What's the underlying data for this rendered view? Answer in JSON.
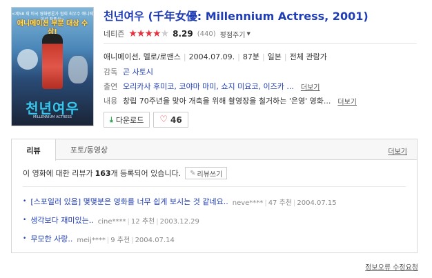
{
  "movie": {
    "title": "천년여우 (千年女優: Millennium Actress, 2001)",
    "poster": {
      "top_text": "<제58 회 미국 영화평론가 협회 최우수 애니메이션 작품상>",
      "headline": "애니메이션 부문 대상 수상!",
      "title_text": "천년여우",
      "subtitle": "MILLENNIUM ACTRESS"
    },
    "netizen_label": "네티즌",
    "stars_on": "★★★★",
    "stars_off": "★",
    "score": "8.29",
    "vote_count": "(440)",
    "rate_label": "평점주기",
    "genre": "애니메이션, 멜로/로맨스",
    "release_date": "2004.07.09.",
    "runtime": "87분",
    "country": "일본",
    "audience_rating": "전체 관람가",
    "director_label": "감독",
    "director": "곤 사토시",
    "cast_label": "출연",
    "cast": "오리카사 후미코, 코야마 마미, 쇼지 미요코, 이즈카 ...",
    "cast_more": "더보기",
    "plot_label": "내용",
    "plot": "창립 70주년을 맞아 개축을 위해 촬영장을 철거하는 '은영' 영화...",
    "plot_more": "더보기",
    "download_label": "다운로드",
    "like_count": "46"
  },
  "reviews": {
    "tabs": [
      "리뷰",
      "포토/동영상"
    ],
    "more_label": "더보기",
    "summary_prefix": "이 영화에 대한 리뷰가",
    "summary_count": "163",
    "summary_suffix": "개 등록되어 있습니다.",
    "write_label": "리뷰쓰기",
    "items": [
      {
        "text": "[스포일러 있음] 몇몇분은 영화를 너무 쉽게 보시는 것 같네요..",
        "author": "neve****",
        "recommend": "47 추천",
        "date": "2004.07.15"
      },
      {
        "text": "생각보다 재미있는..",
        "author": "cine****",
        "recommend": "12 추천",
        "date": "2003.12.29"
      },
      {
        "text": "무모한 사랑..",
        "author": "meij****",
        "recommend": "9 추천",
        "date": "2004.07.14"
      }
    ]
  },
  "footer": {
    "report_label": "정보오류 수정요청"
  }
}
